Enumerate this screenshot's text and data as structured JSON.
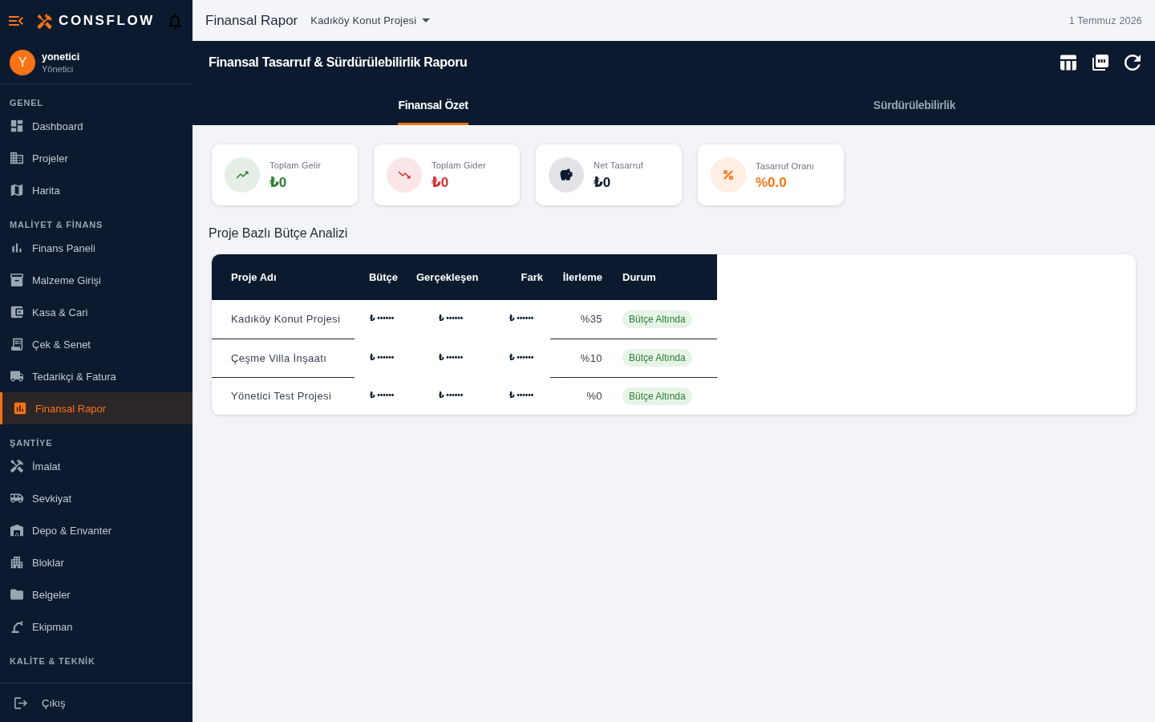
{
  "sidebar": {
    "brand": "CONSFLOW",
    "user": {
      "initial": "Y",
      "name": "yonetici",
      "role": "Yönetici"
    },
    "sections": [
      {
        "title": "GENEL",
        "items": [
          {
            "label": "Dashboard",
            "selected": false
          },
          {
            "label": "Projeler",
            "selected": false
          },
          {
            "label": "Harita",
            "selected": false
          }
        ]
      },
      {
        "title": "MALİYET & FİNANS",
        "items": [
          {
            "label": "Finans Paneli",
            "selected": false
          },
          {
            "label": "Malzeme Girişi",
            "selected": false
          },
          {
            "label": "Kasa & Cari",
            "selected": false
          },
          {
            "label": "Çek & Senet",
            "selected": false
          },
          {
            "label": "Tedarikçi & Fatura",
            "selected": false
          },
          {
            "label": "Finansal Rapor",
            "selected": true
          }
        ]
      },
      {
        "title": "ŞANTİYE",
        "items": [
          {
            "label": "İmalat",
            "selected": false
          },
          {
            "label": "Sevkiyat",
            "selected": false
          },
          {
            "label": "Depo & Envanter",
            "selected": false
          },
          {
            "label": "Bloklar",
            "selected": false
          },
          {
            "label": "Belgeler",
            "selected": false
          },
          {
            "label": "Ekipman",
            "selected": false
          }
        ]
      },
      {
        "title": "KALİTE & TEKNİK"
      }
    ],
    "logout": "Çıkış"
  },
  "topbar": {
    "title": "Finansal Rapor",
    "project_select": "Kadıköy Konut Projesi",
    "date": "1 Temmuz 2026"
  },
  "report": {
    "title": "Finansal Tasarruf & Sürdürülebilirlik Raporu",
    "tabs": [
      {
        "label": "Finansal Özet",
        "selected": true
      },
      {
        "label": "Sürdürülebilirlik",
        "selected": false
      }
    ]
  },
  "summary_cards": [
    {
      "label": "Toplam Gelir",
      "value": "₺0",
      "color": "#2e7d32"
    },
    {
      "label": "Toplam Gider",
      "value": "₺0",
      "color": "#d32f2f"
    },
    {
      "label": "Net Tasarruf",
      "value": "₺0",
      "color": "#0b1a2e"
    },
    {
      "label": "Tasarruf Oranı",
      "value": "%0.0",
      "color": "#f97316"
    }
  ],
  "budget_table": {
    "title": "Proje Bazlı Bütçe Analizi",
    "columns": [
      "Proje Adı",
      "Bütçe",
      "Gerçekleşen",
      "Fark",
      "İlerleme",
      "Durum"
    ],
    "rows": [
      {
        "project": "Kadıköy Konut Projesi",
        "budget": "₺ ••••••",
        "actual": "₺ ••••••",
        "difference": "₺ ••••••",
        "progress": "%35",
        "status": "Bütçe Altında"
      },
      {
        "project": "Çeşme Villa İnşaatı",
        "budget": "₺ ••••••",
        "actual": "₺ ••••••",
        "difference": "₺ ••••••",
        "progress": "%10",
        "status": "Bütçe Altında"
      },
      {
        "project": "Yönetici Test Projesi",
        "budget": "₺ ••••••",
        "actual": "₺ ••••••",
        "difference": "₺ ••••••",
        "progress": "%0",
        "status": "Bütçe Altında"
      }
    ]
  }
}
